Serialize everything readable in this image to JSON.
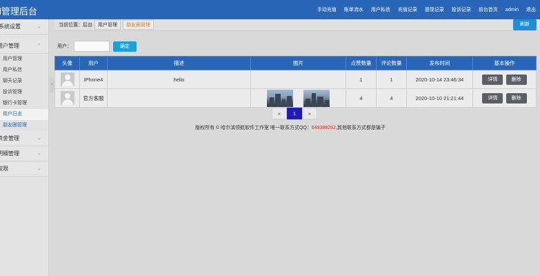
{
  "header": {
    "brand": "l管理后台",
    "nav": [
      "手动充值",
      "账单流水",
      "用户私信",
      "充值记录",
      "提现记录",
      "投诉记录",
      "前台首页",
      "admin",
      "退出"
    ]
  },
  "sidebar": {
    "groups": [
      {
        "label": "系统设置"
      },
      {
        "label": "用户管理",
        "items": [
          "用户管理",
          "用户私信",
          "聊天记录",
          "投诉管理",
          "银行卡管理",
          "用户日志",
          "朋友圈管理"
        ]
      },
      {
        "label": "资金管理"
      },
      {
        "label": "明细管理"
      },
      {
        "label": "权限"
      }
    ]
  },
  "breadcrumb": {
    "label": "当前位置：后台",
    "tabs": [
      "用户管理",
      "朋友圈管理"
    ],
    "refresh": "刷新"
  },
  "filter": {
    "label": "用户：",
    "placeholder": "",
    "button": "确定"
  },
  "table": {
    "columns": [
      "头像",
      "用户",
      "描述",
      "图片",
      "点赞数量",
      "评论数量",
      "发布时间",
      "基本操作"
    ],
    "rows": [
      {
        "user": "iPhone4",
        "desc": "hello",
        "likes": "1",
        "comments": "1",
        "time": "2020-10-14 23:46:34"
      },
      {
        "user": "官方客服",
        "desc": "",
        "likes": "4",
        "comments": "4",
        "time": "2020-10-10 21:21:44"
      }
    ],
    "actions": [
      "详情",
      "删除"
    ]
  },
  "pager": {
    "prev": "«",
    "page": "1",
    "next": "»"
  },
  "footer": {
    "prefix": "版权所有 © 哈尔滨领航软件工作室 唯一联系方式QQ：",
    "qq": "649398262",
    "suffix": ",其他联系方式都是骗子"
  },
  "colors": {
    "header_bg": "#2a66b8",
    "accent_button": "#1d8fd8",
    "pager_active": "#1d1db5",
    "highlight": "#c0392b"
  }
}
